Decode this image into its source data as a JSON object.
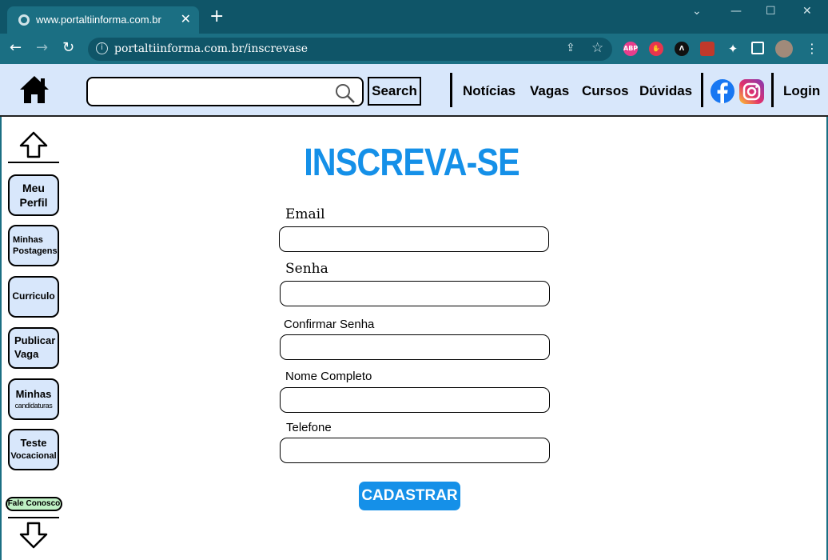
{
  "browser": {
    "tab_title": "www.portaltiinforma.com.br",
    "tab_close": "✕",
    "new_tab": "+",
    "url": "portaltiinforma.com.br/inscrevase",
    "window_controls": [
      "⌄",
      "—",
      "☐",
      "✕"
    ],
    "extensions": [
      "ABP"
    ]
  },
  "header": {
    "search_button": "Search",
    "search_placeholder": "",
    "nav": [
      "Notícias",
      "Vagas",
      "Cursos",
      "Dúvidas"
    ],
    "login": "Login"
  },
  "sidebar": {
    "items": [
      {
        "line1": "Meu",
        "line2": "Perfil"
      },
      {
        "line1": "Minhas",
        "line2": "Postagens"
      },
      {
        "line1": "Curriculo",
        "line2": ""
      },
      {
        "line1": "Publicar",
        "line2": "Vaga"
      },
      {
        "line1": "Minhas",
        "line2": "candidaturas"
      },
      {
        "line1": "Teste",
        "line2": "Vocacional"
      }
    ],
    "contact": "Fale Conosco"
  },
  "form": {
    "title": "INSCREVA-SE",
    "fields": [
      {
        "label": "Email",
        "value": ""
      },
      {
        "label": "Senha",
        "value": ""
      },
      {
        "label": "Confirmar Senha",
        "value": ""
      },
      {
        "label": "Nome Completo",
        "value": ""
      },
      {
        "label": "Telefone",
        "value": ""
      }
    ],
    "submit": "CADASTRAR"
  },
  "colors": {
    "accent": "#1590e8",
    "header_bg": "#d8e7fb",
    "browser_frame": "#1b6f83",
    "contact_bg": "#bff0c4"
  }
}
